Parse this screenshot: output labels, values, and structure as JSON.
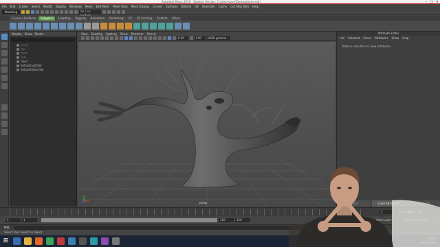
{
  "window": {
    "title": "Autodesk Maya 2016 - Student Version: C:\\Users\\user\\Desktop\\tree.mb*"
  },
  "menus": [
    "File",
    "Edit",
    "Create",
    "Select",
    "Modify",
    "Display",
    "Windows",
    "Mesh",
    "Edit Mesh",
    "Mesh Tools",
    "Mesh Display",
    "Curves",
    "Surfaces",
    "Deform",
    "UV",
    "Generate",
    "Cache",
    "Cut Ship Slim",
    "Help"
  ],
  "status": {
    "mode": "Modeling",
    "live_surface": "No Live Surface"
  },
  "shelf_tabs": [
    {
      "label": "Curves / Surfaces",
      "active": false
    },
    {
      "label": "Polygons",
      "active": true
    },
    {
      "label": "Sculpting",
      "active": false
    },
    {
      "label": "Rigging",
      "active": false
    },
    {
      "label": "Animation",
      "active": false
    },
    {
      "label": "Rendering",
      "active": false
    },
    {
      "label": "FX",
      "active": false
    },
    {
      "label": "FX Caching",
      "active": false
    },
    {
      "label": "Custom",
      "active": false
    },
    {
      "label": "XGen",
      "active": false
    }
  ],
  "outliner": {
    "menu": [
      "Display",
      "Show",
      "Panels"
    ],
    "items": [
      {
        "label": "persp",
        "dim": true
      },
      {
        "label": "top",
        "dim": true
      },
      {
        "label": "front",
        "dim": true
      },
      {
        "label": "side",
        "dim": true
      },
      {
        "label": "tree1",
        "dim": false
      },
      {
        "label": "defaultLightSet",
        "dim": false
      },
      {
        "label": "defaultObjectSet",
        "dim": false
      }
    ]
  },
  "viewport": {
    "menu": [
      "View",
      "Shading",
      "Lighting",
      "Show",
      "Renderer",
      "Panels"
    ],
    "field_a": "0.00",
    "field_b": "1.00",
    "colorspace": "sRGB gamma",
    "camera": "persp"
  },
  "attribute_editor": {
    "title": "Attribute Editor",
    "menu": [
      "List",
      "Selected",
      "Focus",
      "Attributes",
      "Show",
      "Help"
    ],
    "message": "Make a selection to view attributes",
    "buttons": [
      {
        "label": "Select",
        "on": false
      },
      {
        "label": "Load Attributes",
        "on": true
      },
      {
        "label": "Copy Tab",
        "on": false
      }
    ]
  },
  "timeline": {
    "current_frame": "1",
    "range_start": "1",
    "range_start_inner": "1",
    "range_end_inner": "120",
    "range_end": "120",
    "anim_layer": "No Anim Layer",
    "character_set": "No Character Set"
  },
  "command": {
    "label": "MEL"
  },
  "help_line": "Select Tool: select an object",
  "tray": {
    "time": "18:24",
    "date": "03/03/2016"
  }
}
